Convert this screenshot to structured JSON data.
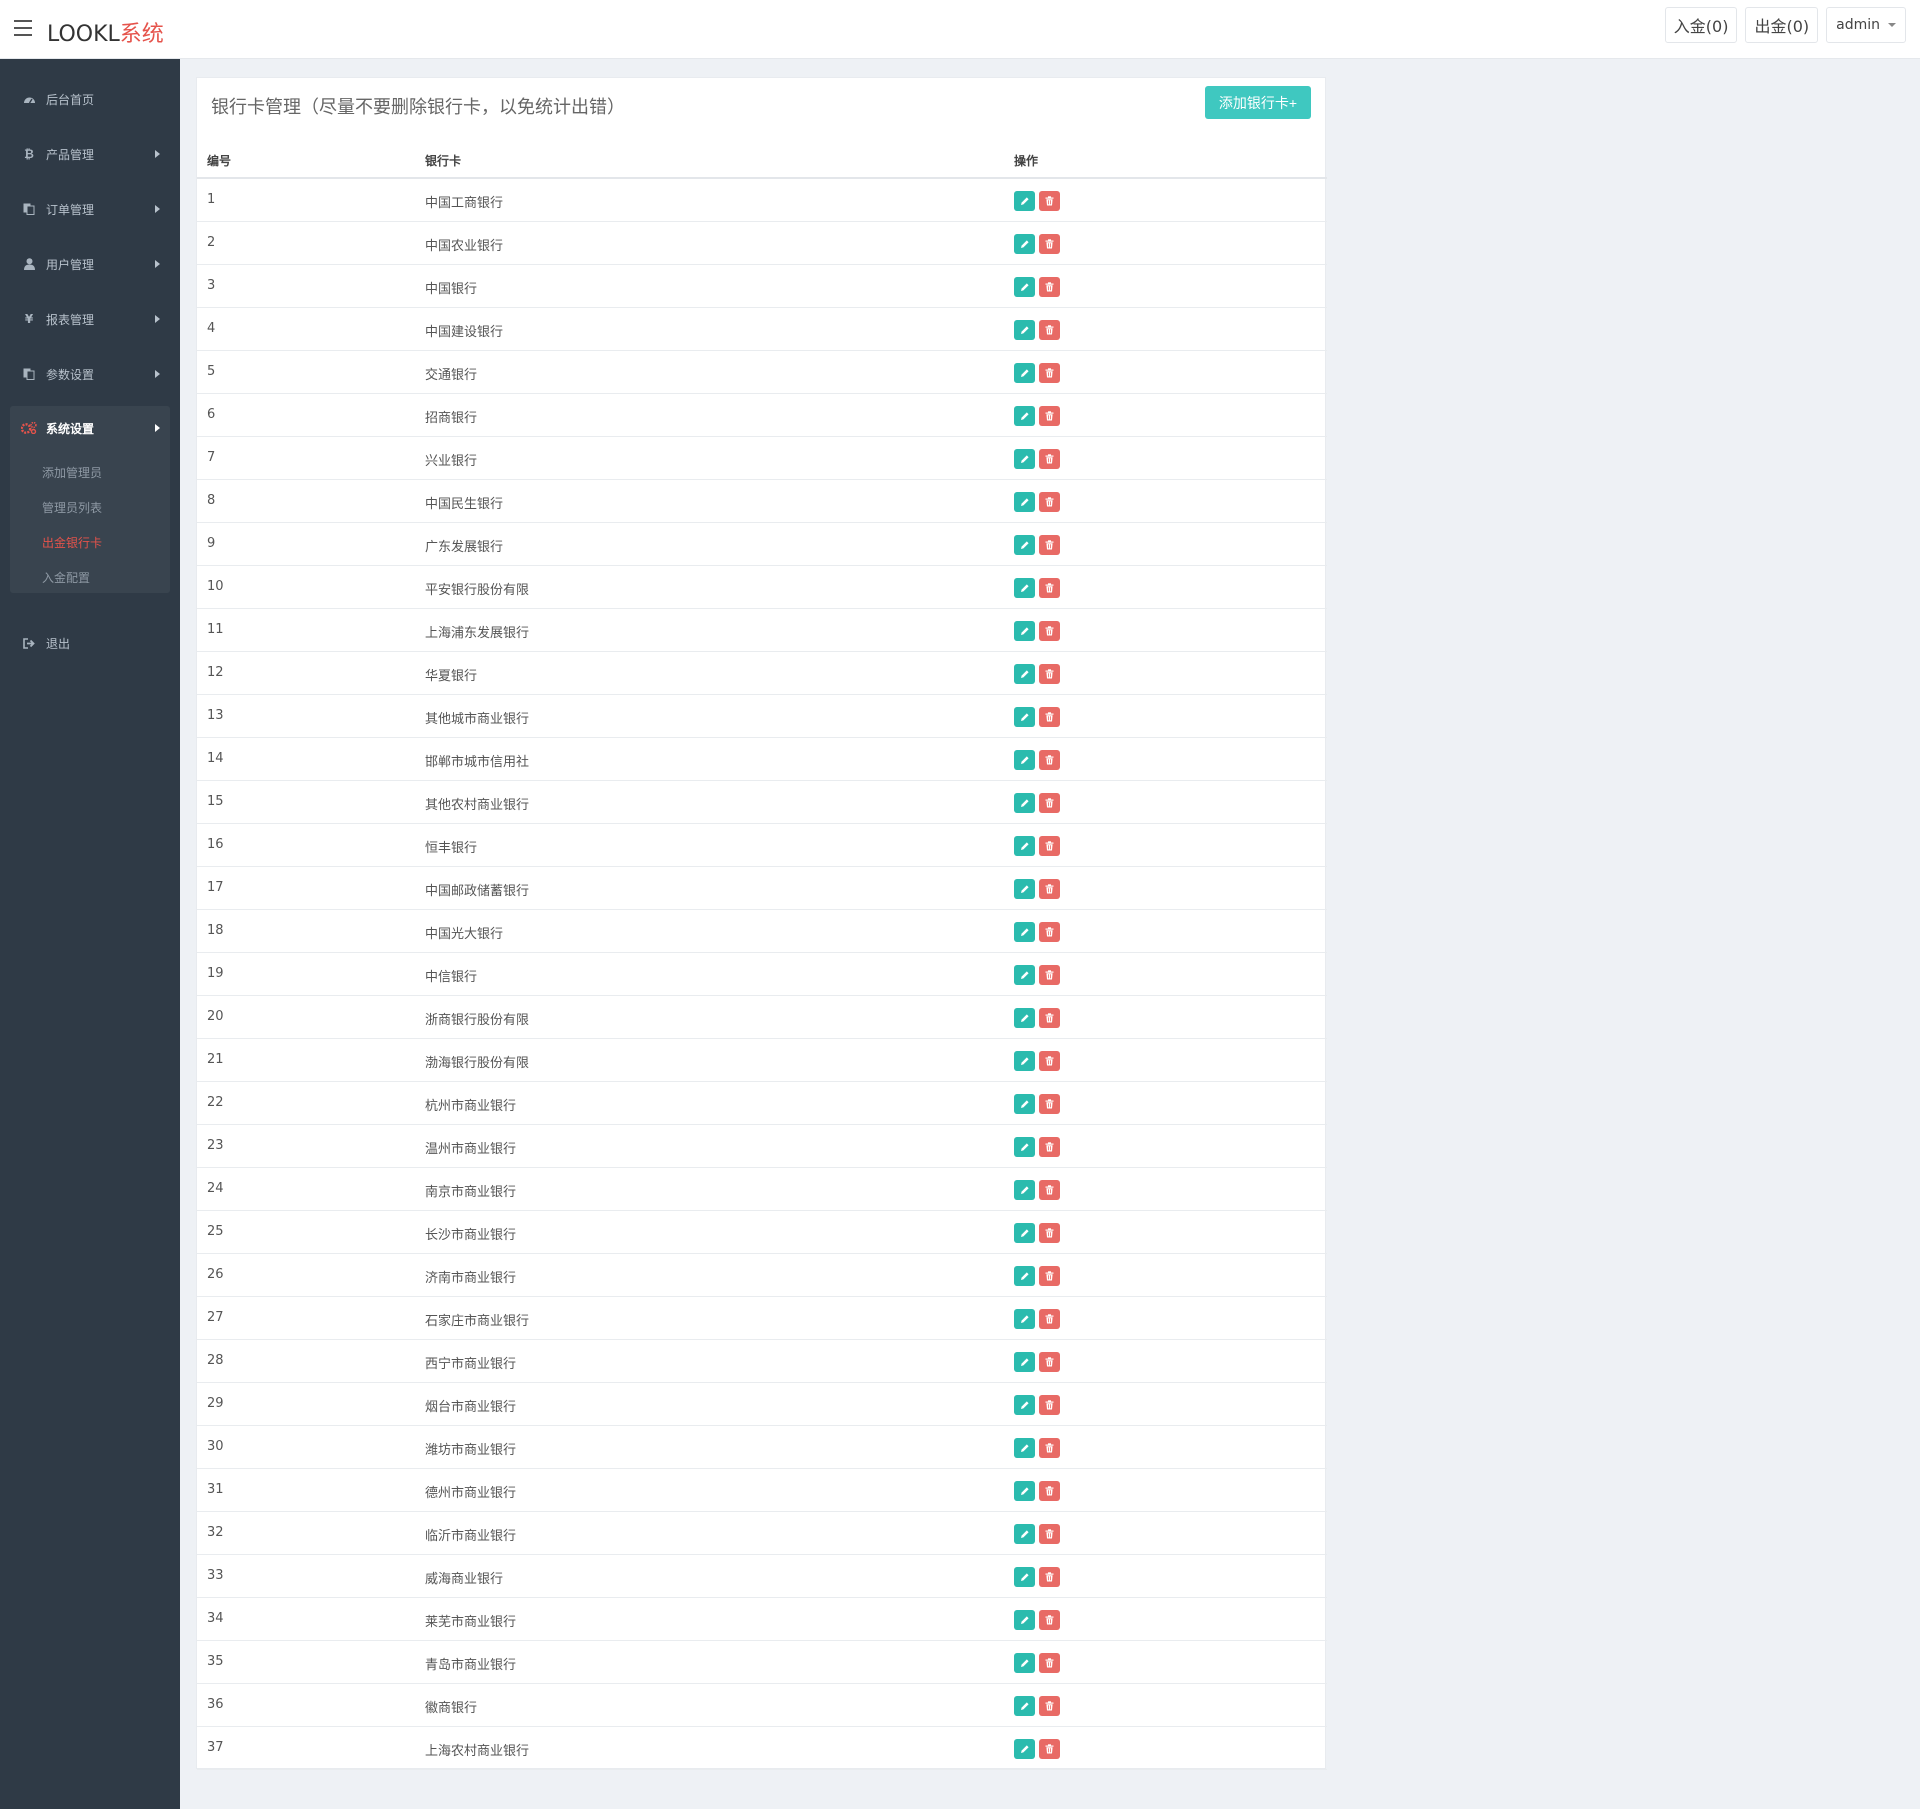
{
  "app": {
    "brand_main": "LOOKL",
    "brand_accent": "系统"
  },
  "header": {
    "deposit_label": "入金(0)",
    "withdraw_label": "出金(0)",
    "user_label": "admin"
  },
  "sidebar": {
    "items": [
      {
        "label": "后台首页",
        "icon": "dashboard-icon"
      },
      {
        "label": "产品管理",
        "icon": "bitcoin-icon"
      },
      {
        "label": "订单管理",
        "icon": "copy-icon"
      },
      {
        "label": "用户管理",
        "icon": "user-icon"
      },
      {
        "label": "报表管理",
        "icon": "yen-icon"
      },
      {
        "label": "参数设置",
        "icon": "copy-icon"
      },
      {
        "label": "系统设置",
        "icon": "gears-icon"
      },
      {
        "label": "退出",
        "icon": "sign-out-icon"
      }
    ],
    "submenu": [
      {
        "label": "添加管理员"
      },
      {
        "label": "管理员列表"
      },
      {
        "label": "出金银行卡"
      },
      {
        "label": "入金配置"
      }
    ]
  },
  "panel": {
    "title": "银行卡管理（尽量不要删除银行卡，以免统计出错）",
    "add_button": "添加银行卡+"
  },
  "table": {
    "headers": [
      "编号",
      "银行卡",
      "操作"
    ],
    "rows": [
      {
        "id": "1",
        "bank": "中国工商银行"
      },
      {
        "id": "2",
        "bank": "中国农业银行"
      },
      {
        "id": "3",
        "bank": "中国银行"
      },
      {
        "id": "4",
        "bank": "中国建设银行"
      },
      {
        "id": "5",
        "bank": "交通银行"
      },
      {
        "id": "6",
        "bank": "招商银行"
      },
      {
        "id": "7",
        "bank": "兴业银行"
      },
      {
        "id": "8",
        "bank": "中国民生银行"
      },
      {
        "id": "9",
        "bank": "广东发展银行"
      },
      {
        "id": "10",
        "bank": "平安银行股份有限"
      },
      {
        "id": "11",
        "bank": "上海浦东发展银行"
      },
      {
        "id": "12",
        "bank": "华夏银行"
      },
      {
        "id": "13",
        "bank": "其他城市商业银行"
      },
      {
        "id": "14",
        "bank": "邯郸市城市信用社"
      },
      {
        "id": "15",
        "bank": "其他农村商业银行"
      },
      {
        "id": "16",
        "bank": "恒丰银行"
      },
      {
        "id": "17",
        "bank": "中国邮政储蓄银行"
      },
      {
        "id": "18",
        "bank": "中国光大银行"
      },
      {
        "id": "19",
        "bank": "中信银行"
      },
      {
        "id": "20",
        "bank": "浙商银行股份有限"
      },
      {
        "id": "21",
        "bank": "渤海银行股份有限"
      },
      {
        "id": "22",
        "bank": "杭州市商业银行"
      },
      {
        "id": "23",
        "bank": "温州市商业银行"
      },
      {
        "id": "24",
        "bank": "南京市商业银行"
      },
      {
        "id": "25",
        "bank": "长沙市商业银行"
      },
      {
        "id": "26",
        "bank": "济南市商业银行"
      },
      {
        "id": "27",
        "bank": "石家庄市商业银行"
      },
      {
        "id": "28",
        "bank": "西宁市商业银行"
      },
      {
        "id": "29",
        "bank": "烟台市商业银行"
      },
      {
        "id": "30",
        "bank": "潍坊市商业银行"
      },
      {
        "id": "31",
        "bank": "德州市商业银行"
      },
      {
        "id": "32",
        "bank": "临沂市商业银行"
      },
      {
        "id": "33",
        "bank": "威海商业银行"
      },
      {
        "id": "34",
        "bank": "莱芜市商业银行"
      },
      {
        "id": "35",
        "bank": "青岛市商业银行"
      },
      {
        "id": "36",
        "bank": "徽商银行"
      },
      {
        "id": "37",
        "bank": "上海农村商业银行"
      }
    ]
  },
  "colors": {
    "sidebar_bg": "#2f3a46",
    "accent_red": "#e5534b",
    "add_button": "#3fc8c0",
    "edit_button": "#2bbbae",
    "delete_button": "#e86a65"
  }
}
